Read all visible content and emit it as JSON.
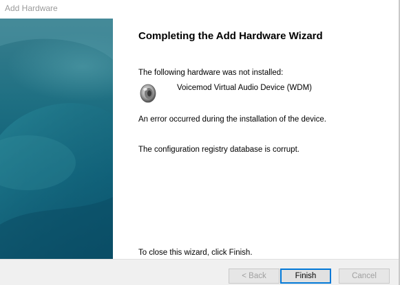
{
  "window": {
    "title": "Add Hardware"
  },
  "wizard": {
    "heading": "Completing the Add Hardware Wizard",
    "not_installed_text": "The following hardware was not installed:",
    "device_name": "Voicemod Virtual Audio Device (WDM)",
    "device_icon": "speaker-icon",
    "error_text": "An error occurred during the installation of the device.",
    "detail_text": "The configuration registry database is corrupt.",
    "close_hint": "To close this wizard, click Finish."
  },
  "buttons": {
    "back_label": "< Back",
    "finish_label": "Finish",
    "cancel_label": "Cancel"
  },
  "colors": {
    "banner": "#1e6f82",
    "default_button_border": "#0078d7"
  }
}
